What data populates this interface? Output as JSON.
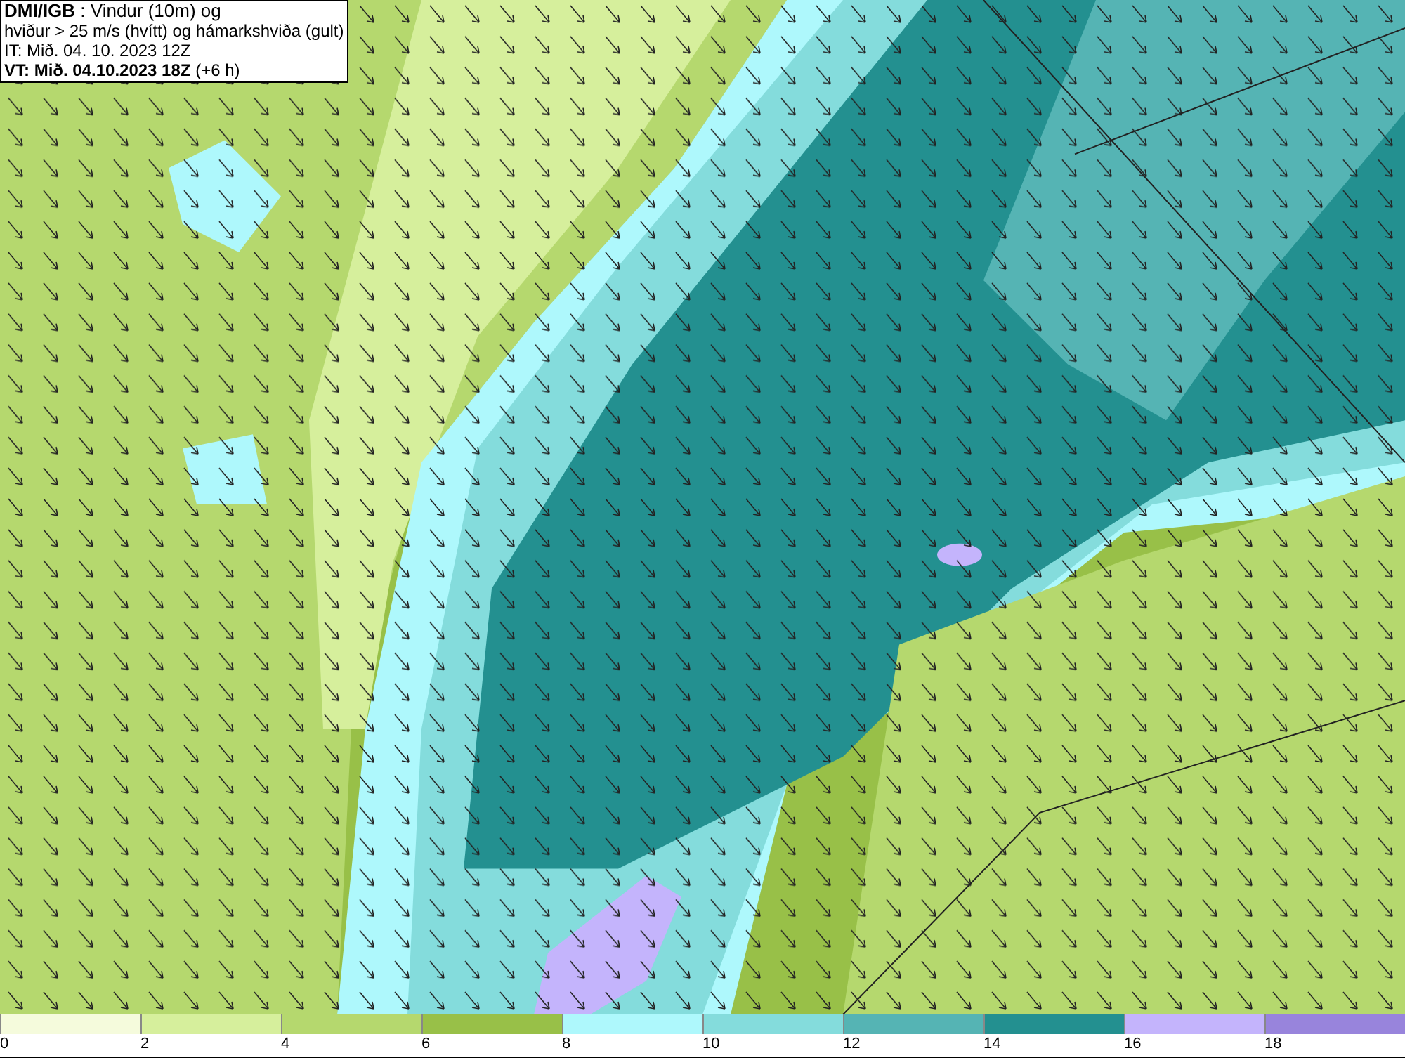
{
  "header": {
    "lines": [
      "**DMI/IGB** : Vindur (10m) og",
      "hviður > 25 m/s (hvítt) og hámarkshviða (gult)",
      "IT: Mið. 04. 10. 2023 12Z",
      "**VT: Mið. 04.10.2023 18Z** (+6 h)"
    ]
  },
  "legend": {
    "bins": [
      {
        "label": "0",
        "color": "#f5fbdc"
      },
      {
        "label": "2",
        "color": "#d6ef9c"
      },
      {
        "label": "4",
        "color": "#b5d86e"
      },
      {
        "label": "6",
        "color": "#98c048"
      },
      {
        "label": "8",
        "color": "#aef8fc"
      },
      {
        "label": "10",
        "color": "#84dcdc"
      },
      {
        "label": "12",
        "color": "#55b4b4"
      },
      {
        "label": "14",
        "color": "#239090"
      },
      {
        "label": "16",
        "color": "#c4b4fc"
      },
      {
        "label": "18",
        "color": "#9884dc"
      }
    ]
  }
}
